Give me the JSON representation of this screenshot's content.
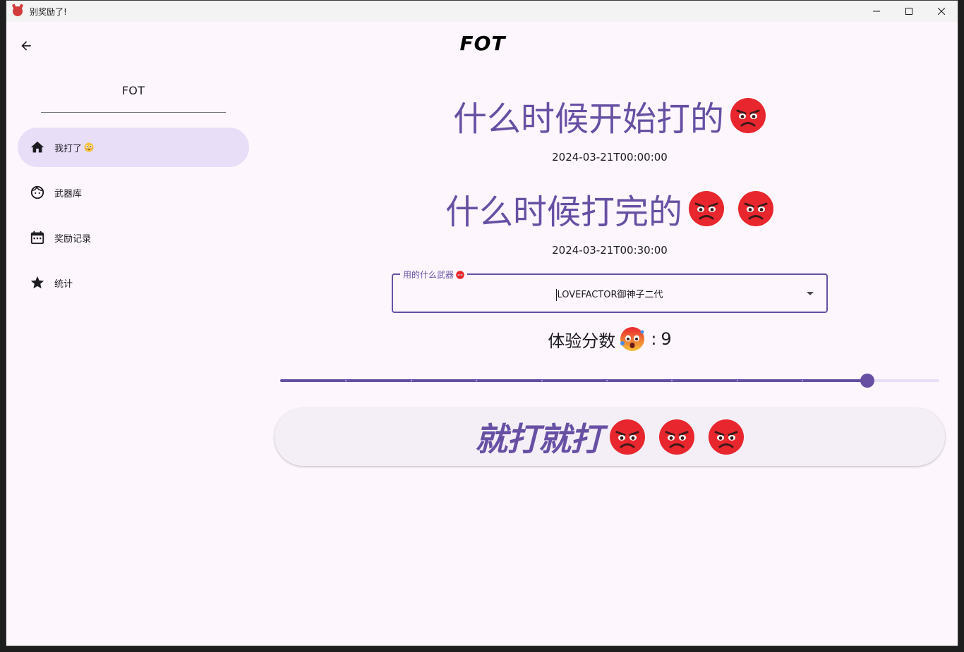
{
  "window": {
    "title": "别奖励了!"
  },
  "sidebar": {
    "header": "FOT",
    "items": [
      {
        "label": "我打了",
        "icon": "home-icon",
        "active": true,
        "emoji": "flushed-face-emoji"
      },
      {
        "label": "武器库",
        "icon": "face-icon",
        "active": false
      },
      {
        "label": "奖励记录",
        "icon": "calendar-icon",
        "active": false
      },
      {
        "label": "统计",
        "icon": "star-icon",
        "active": false
      }
    ]
  },
  "appbar": {
    "title": "FOT"
  },
  "main": {
    "start_heading": "什么时候开始打的",
    "start_datetime": "2024-03-21T00:00:00",
    "end_heading": "什么时候打完的",
    "end_datetime": "2024-03-21T00:30:00",
    "weapon": {
      "label": "用的什么武器",
      "value": "LOVEFACTOR御神子二代"
    },
    "score": {
      "label": "体验分数",
      "separator": ":",
      "value": "9",
      "max": 10
    },
    "submit_label": "就打就打"
  },
  "colors": {
    "primary": "#6750a4",
    "active_nav": "#e8def8",
    "background": "#fdf7fd",
    "angry_red": "#e8262d"
  }
}
